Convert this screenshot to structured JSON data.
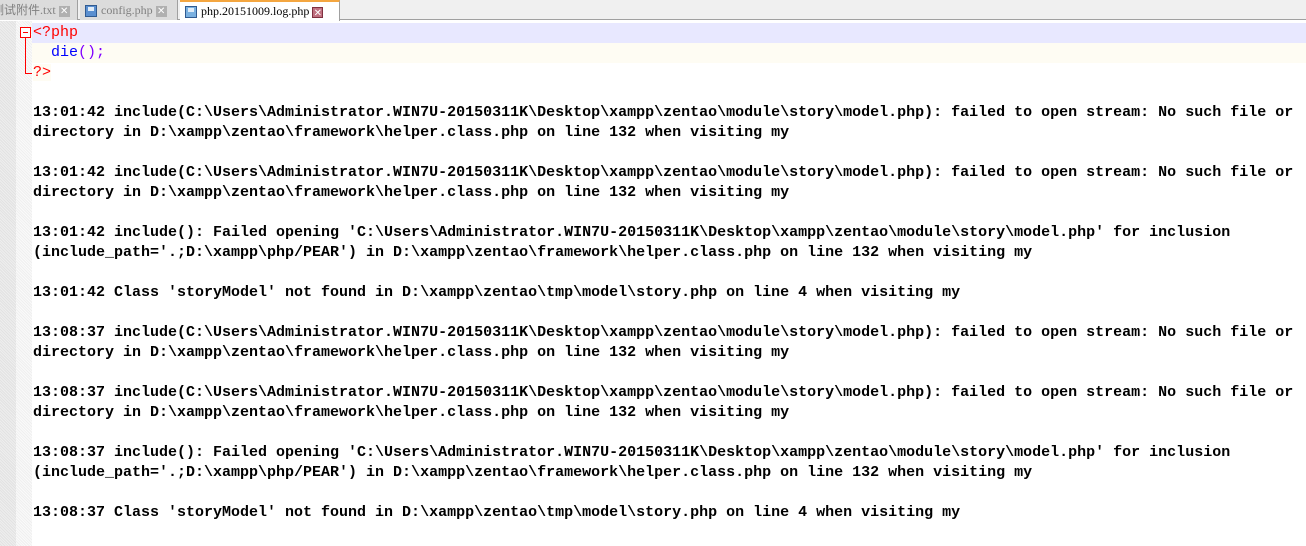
{
  "tabs": [
    {
      "label": "测试附件.txt",
      "active": false
    },
    {
      "label": "config.php",
      "active": false
    },
    {
      "label": "php.20151009.log.php",
      "active": true
    }
  ],
  "code": {
    "open": "<?php",
    "die_fn": "die",
    "die_paren": "();",
    "close": "?>"
  },
  "entries": [
    "13:01:42 include(C:\\Users\\Administrator.WIN7U-20150311K\\Desktop\\xampp\\zentao\\module\\story\\model.php): failed to open stream: No such file or directory in D:\\xampp\\zentao\\framework\\helper.class.php on line 132 when visiting my",
    "13:01:42 include(C:\\Users\\Administrator.WIN7U-20150311K\\Desktop\\xampp\\zentao\\module\\story\\model.php): failed to open stream: No such file or directory in D:\\xampp\\zentao\\framework\\helper.class.php on line 132 when visiting my",
    "13:01:42 include(): Failed opening 'C:\\Users\\Administrator.WIN7U-20150311K\\Desktop\\xampp\\zentao\\module\\story\\model.php' for inclusion (include_path='.;D:\\xampp\\php/PEAR') in D:\\xampp\\zentao\\framework\\helper.class.php on line 132 when visiting my",
    "13:01:42 Class 'storyModel' not found in D:\\xampp\\zentao\\tmp\\model\\story.php on line 4 when visiting my",
    "13:08:37 include(C:\\Users\\Administrator.WIN7U-20150311K\\Desktop\\xampp\\zentao\\module\\story\\model.php): failed to open stream: No such file or directory in D:\\xampp\\zentao\\framework\\helper.class.php on line 132 when visiting my",
    "13:08:37 include(C:\\Users\\Administrator.WIN7U-20150311K\\Desktop\\xampp\\zentao\\module\\story\\model.php): failed to open stream: No such file or directory in D:\\xampp\\zentao\\framework\\helper.class.php on line 132 when visiting my",
    "13:08:37 include(): Failed opening 'C:\\Users\\Administrator.WIN7U-20150311K\\Desktop\\xampp\\zentao\\module\\story\\model.php' for inclusion (include_path='.;D:\\xampp\\php/PEAR') in D:\\xampp\\zentao\\framework\\helper.class.php on line 132 when visiting my",
    "13:08:37 Class 'storyModel' not found in D:\\xampp\\zentao\\tmp\\model\\story.php on line 4 when visiting my"
  ]
}
